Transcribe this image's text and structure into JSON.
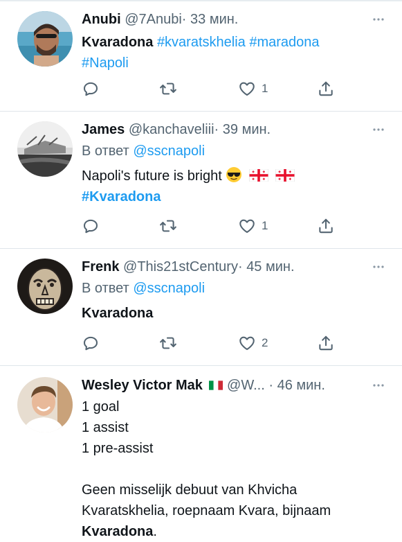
{
  "tweets": [
    {
      "author": "Anubi",
      "handle": "@7Anubi",
      "sep": "·",
      "time": "33 мин.",
      "text_lead": "Kvaradona",
      "hashtags": [
        "#kvaratskhelia",
        "#maradona",
        "#Napoli"
      ],
      "counts": {
        "likes": "1"
      }
    },
    {
      "author": "James",
      "handle": "@kanchaveliii",
      "sep": "·",
      "time": "39 мин.",
      "reply_prefix": "В ответ",
      "reply_to": "@sscnapoli",
      "text": "Napoli's future is bright",
      "hashtag": "#Kvaradona",
      "emoji": [
        "sunglasses-face-emoji",
        "georgia-flag-emoji",
        "georgia-flag-emoji"
      ],
      "counts": {
        "likes": "1"
      }
    },
    {
      "author": "Frenk",
      "handle": "@This21stCentury",
      "sep": "·",
      "time": "45 мин.",
      "reply_prefix": "В ответ",
      "reply_to": "@sscnapoli",
      "text": "Kvaradona",
      "counts": {
        "likes": "2"
      }
    },
    {
      "author": "Wesley Victor Mak",
      "handle": "@W...",
      "sep": "·",
      "time": "46 мин.",
      "flag": "italy-flag-emoji",
      "lines": [
        "1 goal",
        "1 assist",
        "1 pre-assist"
      ],
      "para_1": "Geen misselijk debuut van Khvicha",
      "para_2": "Kvaratskhelia, roepnaam Kvara, bijnaam",
      "para_bold": "Kvaradona",
      "para_end": "."
    }
  ],
  "colors": {
    "text": "#0f1419",
    "secondary": "#536471",
    "accent": "#1d9bf0",
    "divider": "#dfe5ea"
  },
  "icons": [
    "reply-icon",
    "retweet-icon",
    "like-icon",
    "share-icon",
    "more-icon"
  ]
}
